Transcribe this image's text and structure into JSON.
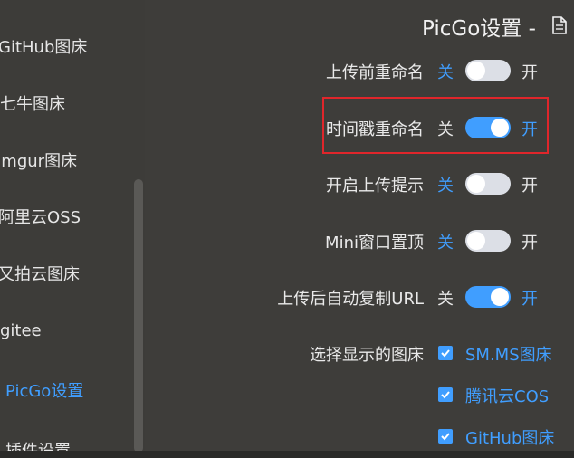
{
  "sidebar": {
    "items": [
      {
        "label": "GitHub图床"
      },
      {
        "label": "七牛图床"
      },
      {
        "label": "Imgur图床"
      },
      {
        "label": "阿里云OSS"
      },
      {
        "label": "又拍云图床"
      },
      {
        "label": "gitee"
      },
      {
        "label": "PicGo设置"
      },
      {
        "label": "插件设置"
      }
    ]
  },
  "main": {
    "title": "PicGo设置 -",
    "title_icon": "document-icon",
    "switch_rows": [
      {
        "label": "上传前重命名",
        "off": "关",
        "on": "开",
        "state": "off"
      },
      {
        "label": "时间戳重命名",
        "off": "关",
        "on": "开",
        "state": "on"
      },
      {
        "label": "开启上传提示",
        "off": "关",
        "on": "开",
        "state": "off"
      },
      {
        "label": "Mini窗口置顶",
        "off": "关",
        "on": "开",
        "state": "off"
      },
      {
        "label": "上传后自动复制URL",
        "off": "关",
        "on": "开",
        "state": "on"
      }
    ],
    "visible_beds": {
      "label": "选择显示的图床",
      "options": [
        {
          "label": "SM.MS图床",
          "checked": true
        },
        {
          "label": "腾讯云COS",
          "checked": true
        },
        {
          "label": "GitHub图床",
          "checked": true
        }
      ]
    }
  },
  "colors": {
    "background": "#3e3d3a",
    "accent": "#409eff",
    "highlight": "#e0262b",
    "switch_off": "#dcdfe6"
  }
}
